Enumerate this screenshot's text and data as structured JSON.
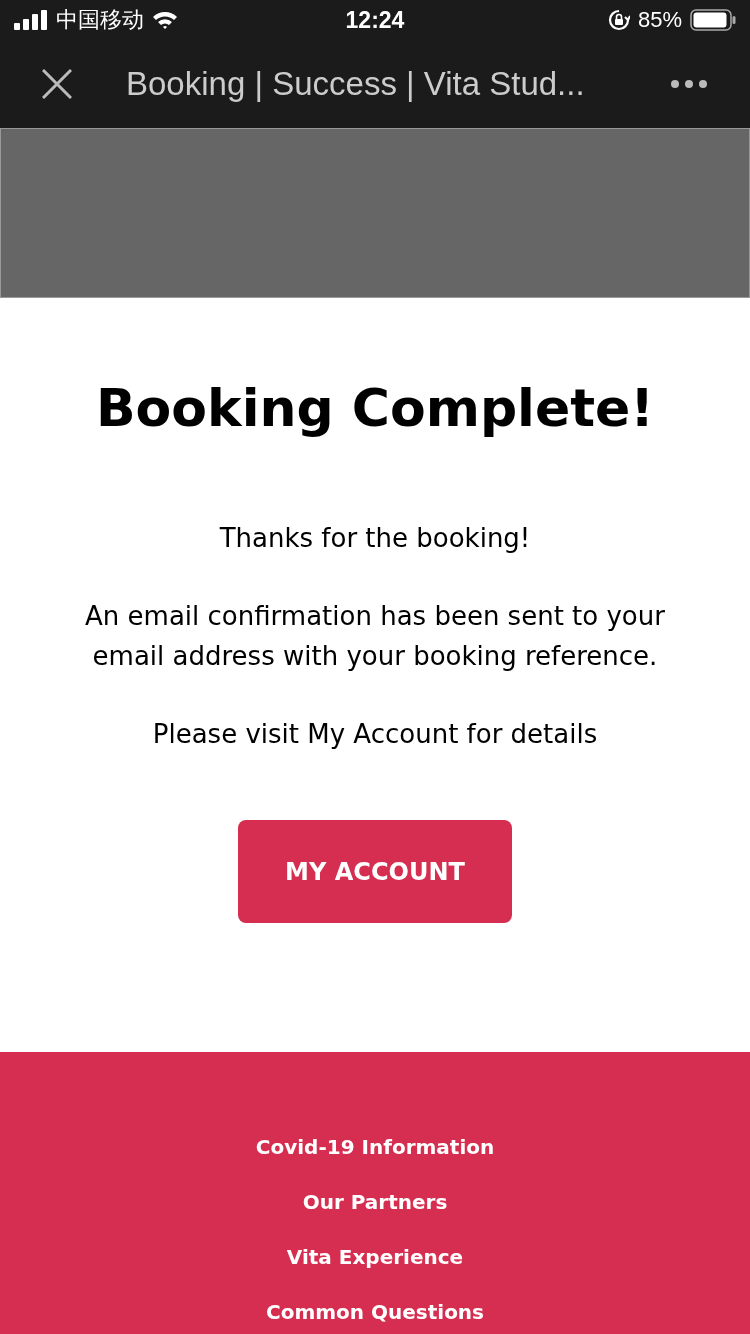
{
  "status_bar": {
    "carrier": "中国移动",
    "time": "12:24",
    "battery": "85%"
  },
  "nav": {
    "title": "Booking | Success | Vita Stud..."
  },
  "banner": {
    "kind": "placeholder"
  },
  "content": {
    "heading": "Booking Complete!",
    "paragraphs": [
      "Thanks for the booking!",
      "An email confirmation has been sent to your email address with your booking reference.",
      "Please visit My Account for details"
    ],
    "button": "MY ACCOUNT"
  },
  "footer": {
    "links": [
      "Covid-19 Information",
      "Our Partners",
      "Vita Experience",
      "Common Questions"
    ]
  }
}
